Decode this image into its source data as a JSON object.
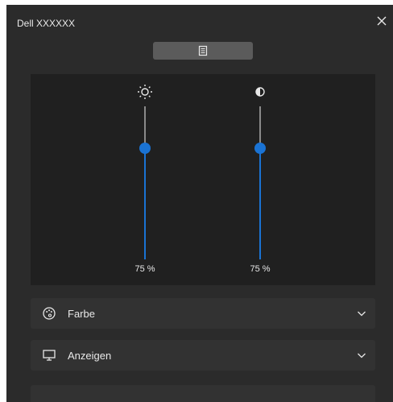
{
  "window": {
    "title": "Dell XXXXXX"
  },
  "icons": {
    "close": "close-icon",
    "mode": "document-icon",
    "brightness": "brightness-sun-icon",
    "contrast": "contrast-icon",
    "farbe": "palette-icon",
    "anzeigen": "monitor-icon",
    "chevron": "chevron-down-icon"
  },
  "colors": {
    "accent": "#1a73d4",
    "background": "#2b2b2b",
    "panel": "#202020",
    "section": "#323232"
  },
  "sliders": {
    "brightness": {
      "level_percent": 75,
      "value_label": "75 %"
    },
    "contrast": {
      "level_percent": 75,
      "value_label": "75 %"
    }
  },
  "sections": [
    {
      "label": "Farbe",
      "expanded": false
    },
    {
      "label": "Anzeigen",
      "expanded": false
    }
  ]
}
